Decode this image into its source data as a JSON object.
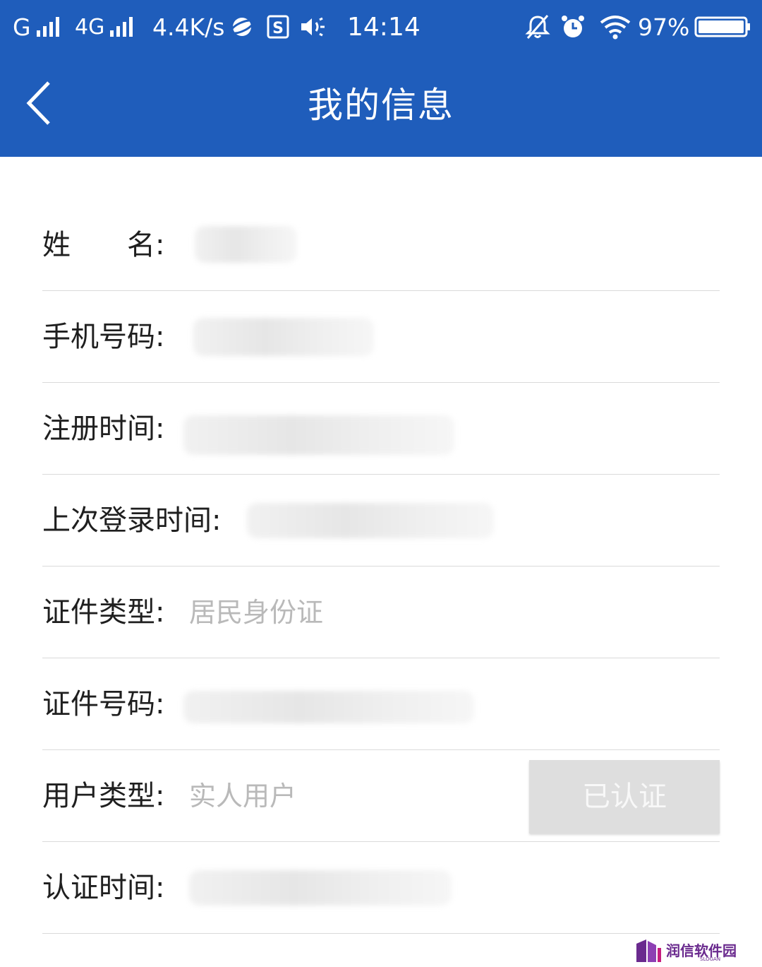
{
  "status_bar": {
    "carrier1": "G",
    "carrier2": "4G",
    "speed": "4.4K/s",
    "time": "14:14",
    "battery": "97%"
  },
  "header": {
    "title": "我的信息"
  },
  "rows": [
    {
      "label": "姓　　名:",
      "value": ""
    },
    {
      "label": "手机号码:",
      "value": ""
    },
    {
      "label": "注册时间:",
      "value": ""
    },
    {
      "label": "上次登录时间:",
      "value": ""
    },
    {
      "label": "证件类型:",
      "value": "居民身份证"
    },
    {
      "label": "证件号码:",
      "value": ""
    },
    {
      "label": "用户类型:",
      "value": "实人用户",
      "button": "已认证"
    },
    {
      "label": "认证时间:",
      "value": ""
    }
  ],
  "watermark": {
    "text": "润信软件园",
    "sub": "SLOGAN"
  },
  "colors": {
    "header_bg": "#1f5dbb",
    "value_gray": "#b9b9b9",
    "button_bg": "#dedede"
  }
}
